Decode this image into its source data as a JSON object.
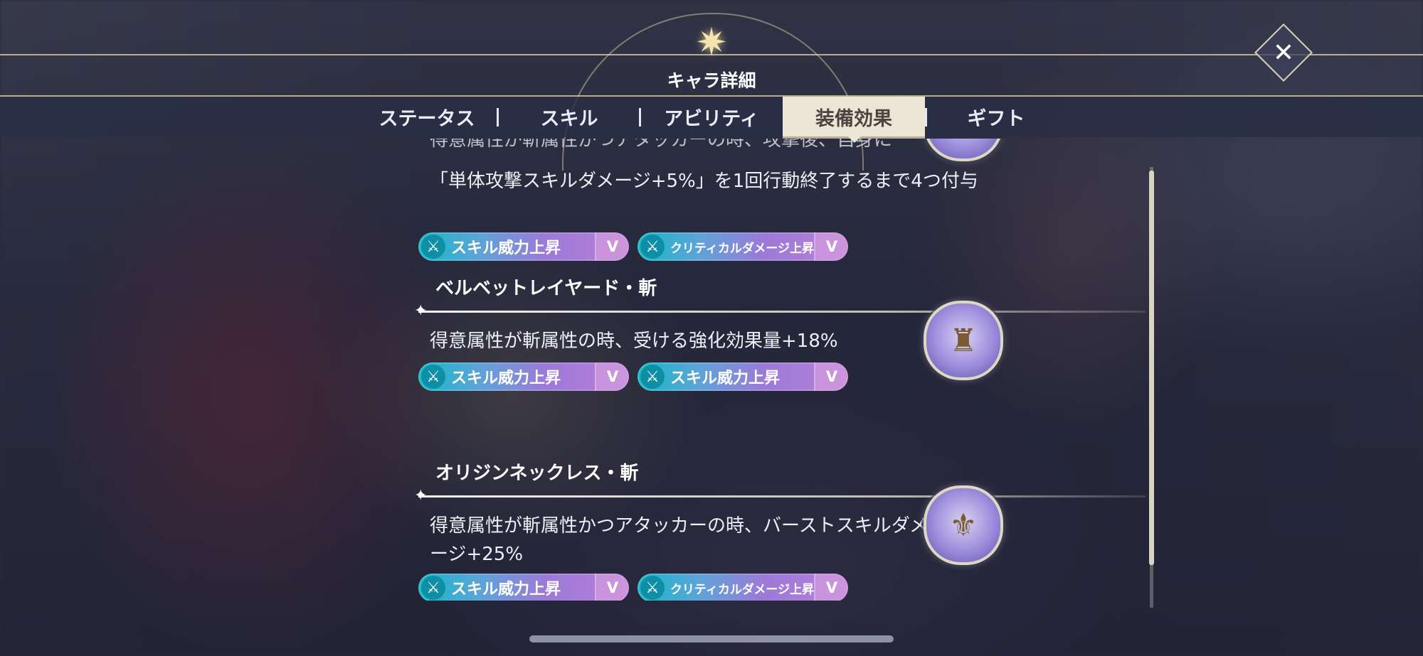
{
  "header": {
    "title": "キャラ詳細",
    "close_symbol": "✕",
    "star_icon": "compass-star-icon"
  },
  "tabs": [
    {
      "label": "ステータス",
      "active": false
    },
    {
      "label": "スキル",
      "active": false
    },
    {
      "label": "アビリティ",
      "active": false
    },
    {
      "label": "装備効果",
      "active": true
    },
    {
      "label": "ギフト",
      "active": false
    }
  ],
  "items": [
    {
      "name": "",
      "desc_partial": "得意属性が斬属性かつアタッカーの時、攻撃後、自身に",
      "desc": "「単体攻撃スキルダメージ+5%」を1回行動終了するまで4つ付与",
      "badges": [
        {
          "label": "スキル威力上昇",
          "rank": "V"
        },
        {
          "label": "クリティカルダメージ上昇",
          "rank": "V"
        }
      ]
    },
    {
      "name": "ベルベットレイヤード・斬",
      "desc": "得意属性が斬属性の時、受ける強化効果量+18%",
      "badges": [
        {
          "label": "スキル威力上昇",
          "rank": "V"
        },
        {
          "label": "スキル威力上昇",
          "rank": "V"
        }
      ]
    },
    {
      "name": "オリジンネックレス・斬",
      "desc": "得意属性が斬属性かつアタッカーの時、バーストスキルダメージ+25%",
      "badges": [
        {
          "label": "スキル威力上昇",
          "rank": "V"
        },
        {
          "label": "クリティカルダメージ上昇",
          "rank": "V"
        }
      ]
    }
  ],
  "badge_icon_glyph": "⚔",
  "colors": {
    "accent_gold": "#e6d7aa",
    "active_tab_bg": "#ece6d6",
    "badge_cyan": "#16b8c8",
    "badge_purple": "#b67fd6"
  }
}
